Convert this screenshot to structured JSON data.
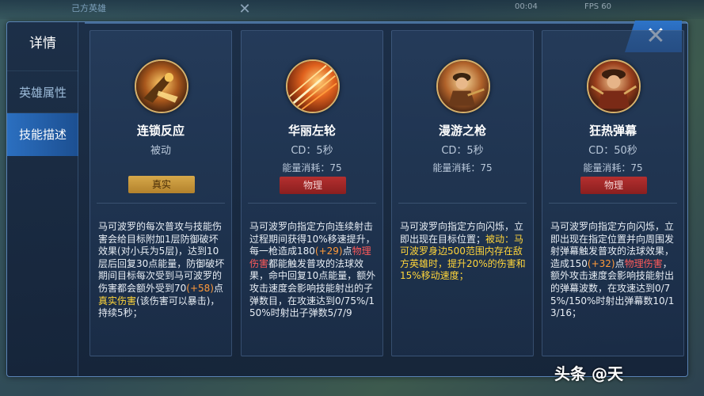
{
  "hud": {
    "team_label": "己方英雄",
    "time": "00:04",
    "fps": "FPS 60"
  },
  "sidebar": {
    "title": "详情",
    "items": [
      {
        "label": "英雄属性",
        "active": false
      },
      {
        "label": "技能描述",
        "active": true
      }
    ]
  },
  "close_label": "✕",
  "skills": [
    {
      "name": "连锁反应",
      "line2": "被动",
      "energy": "",
      "tag": "真实",
      "desc_parts": [
        {
          "t": "马可波罗的每次普攻与技能伤害会给目标附加1层防御破坏效果(对小兵为5层)，达到10层后回复30点能量，防御破坏期间目标每次受到马可波罗的伤害都会额外受到70",
          "c": ""
        },
        {
          "t": "(+58)",
          "c": "orange"
        },
        {
          "t": "点",
          "c": ""
        },
        {
          "t": "真实伤害",
          "c": "yellow"
        },
        {
          "t": "(该伤害可以暴击)，持续5秒；",
          "c": ""
        }
      ]
    },
    {
      "name": "华丽左轮",
      "line2": "CD：5秒",
      "energy": "能量消耗：75",
      "tag": "物理",
      "desc_parts": [
        {
          "t": "马可波罗向指定方向连续射击过程期间获得10%移速提升，每一枪造成180",
          "c": ""
        },
        {
          "t": "(+29)",
          "c": "orange"
        },
        {
          "t": "点",
          "c": ""
        },
        {
          "t": "物理伤害",
          "c": "red"
        },
        {
          "t": "都能触发普攻的法球效果，命中回复10点能量，额外攻击速度会影响技能射出的子弹数目，在攻速达到0/75%/150%时射出子弹数5/7/9",
          "c": ""
        }
      ]
    },
    {
      "name": "漫游之枪",
      "line2": "CD：5秒",
      "energy": "能量消耗：75",
      "tag": "",
      "desc_parts": [
        {
          "t": "马可波罗向指定方向闪烁，立即出现在目标位置；",
          "c": ""
        },
        {
          "t": "被动：马可波罗身边500范围内存在敌方英雄时，提升20%的伤害和15%移动速度；",
          "c": "yellow"
        }
      ]
    },
    {
      "name": "狂热弹幕",
      "line2": "CD：50秒",
      "energy": "能量消耗：75",
      "tag": "物理",
      "desc_parts": [
        {
          "t": "马可波罗向指定方向闪烁，立即出现在指定位置并向周围发射弹幕触发普攻的法球效果，造成150",
          "c": ""
        },
        {
          "t": "(+32)",
          "c": "orange"
        },
        {
          "t": "点",
          "c": ""
        },
        {
          "t": "物理伤害",
          "c": "red"
        },
        {
          "t": "，额外攻击速度会影响技能射出的弹幕波数，在攻速达到0/75%/150%时射出弹幕数10/13/16；",
          "c": ""
        }
      ]
    }
  ],
  "watermark": "头条 @天",
  "colors": {
    "accent_blue": "#2b6fc0",
    "true_damage_gold": "#d6a84a",
    "physical_red": "#b52f2f",
    "highlight_orange": "#ff9a3a",
    "highlight_yellow": "#ffd53a",
    "highlight_red": "#ff5a5a"
  }
}
